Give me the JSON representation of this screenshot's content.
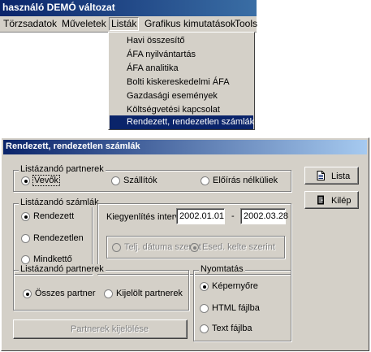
{
  "app": {
    "title": "használó  DEMÓ változat",
    "menu": [
      "Törzsadatok",
      "Műveletek",
      "Listák",
      "Grafikus kimutatások",
      "Tools"
    ],
    "dropdown": [
      "Havi összesítő",
      "ÁFA nyilvántartás",
      "ÁFA analitika",
      "Bolti kiskereskedelmi ÁFA",
      "Gazdasági események",
      "Költségvetési kapcsolat",
      "Rendezett, rendezetlen számlák"
    ]
  },
  "dialog": {
    "title": "Rendezett, rendezetlen számlák",
    "partners_group": {
      "label": "Listázandó partnerek",
      "options": [
        "Vevők",
        "Szállítók",
        "Előírás nélküliek"
      ],
      "selected": "Vevők"
    },
    "invoices_group": {
      "label": "Listázandó számlák",
      "options": [
        "Rendezett",
        "Rendezetlen",
        "Mindkettő"
      ],
      "selected": "Rendezett"
    },
    "interval": {
      "label": "Kiegyenlítés interv.:",
      "from": "2002.01.01",
      "separator": "-",
      "to": "2002.03.28",
      "options": [
        "Telj. dátuma szerint",
        "Esed. kelte szerint"
      ],
      "selected": "Esed. kelte szerint"
    },
    "partners_group2": {
      "label": "Listázandó partnerek",
      "options": [
        "Összes partner",
        "Kijelölt partnerek"
      ],
      "selected": "Összes partner"
    },
    "select_partners_button": "Partnerek kijelölése",
    "print_group": {
      "label": "Nyomtatás",
      "options": [
        "Képernyőre",
        "HTML fájlba",
        "Text fájlba"
      ],
      "selected": "Képernyőre"
    },
    "list_button": "Lista",
    "exit_button": "Kilép"
  }
}
